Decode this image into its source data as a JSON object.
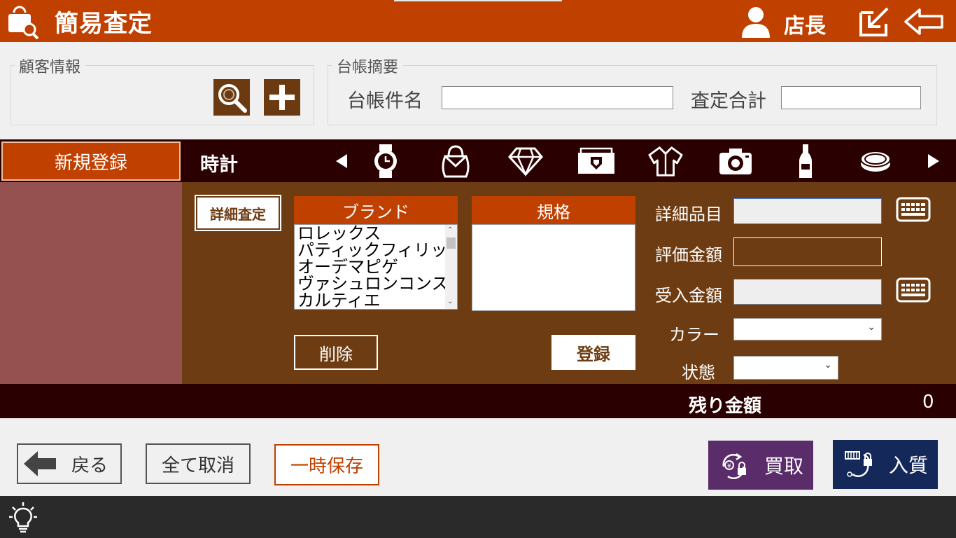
{
  "header": {
    "title": "簡易査定",
    "user": "店長"
  },
  "customer": {
    "legend": "顧客情報"
  },
  "ledger": {
    "legend": "台帳摘要",
    "name_label": "台帳件名",
    "name_value": "",
    "total_label": "査定合計",
    "total_value": ""
  },
  "category": {
    "new_button": "新規登録",
    "current": "時計",
    "icons": [
      "watch-icon",
      "handbag-icon",
      "diamond-icon",
      "wallet-icon",
      "shirt-icon",
      "camera-icon",
      "bottle-icon",
      "coin-icon"
    ]
  },
  "main": {
    "detail_button": "詳細査定",
    "brand_header": "ブランド",
    "brands": [
      "ロレックス",
      "パティックフィリップ",
      "オーデマピゲ",
      "ヴァシュロンコンスタンタン",
      "カルティエ"
    ],
    "spec_header": "規格",
    "delete_button": "削除",
    "register_button": "登録",
    "fields": {
      "item_label": "詳細品目",
      "value_label": "評価金額",
      "received_label": "受入金額",
      "color_label": "カラー",
      "state_label": "状態"
    }
  },
  "remain": {
    "label": "残り金額",
    "value": "0"
  },
  "bottom": {
    "back": "戻る",
    "cancel_all": "全て取消",
    "temp_save": "一時保存",
    "buy": "買取",
    "pawn": "入質"
  },
  "colors": {
    "header": "#c04000",
    "main": "#6e3c12",
    "left": "#955050",
    "dark": "#2b0000",
    "buy": "#5a2d6a",
    "pawn": "#14285a"
  }
}
